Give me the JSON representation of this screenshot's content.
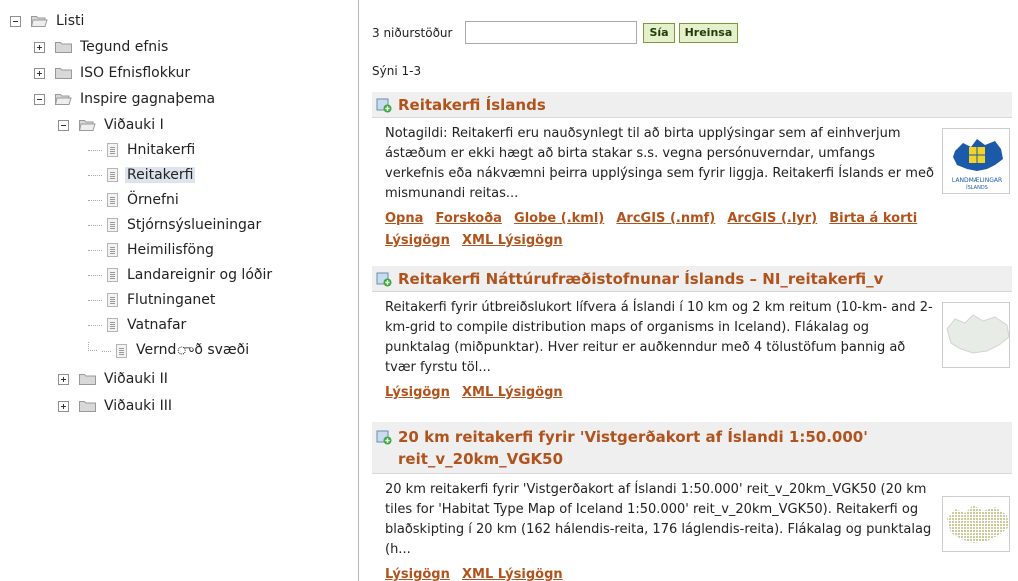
{
  "tree": {
    "root": "Listi",
    "nodes": [
      {
        "label": "Tegund efnis"
      },
      {
        "label": "ISO Efnisflokkur"
      },
      {
        "label": "Inspire gagnaþema"
      },
      {
        "label": "Viðauki I"
      },
      {
        "label": "Hnitakerfi"
      },
      {
        "label": "Reitakerfi"
      },
      {
        "label": "Örnefni"
      },
      {
        "label": "Stjórnsýslueiningar"
      },
      {
        "label": "Heimilisföng"
      },
      {
        "label": "Landareignir og lóðir"
      },
      {
        "label": "Flutninganet"
      },
      {
        "label": "Vatnafar"
      },
      {
        "label": "Verndுð svæði"
      },
      {
        "label": "Viðauki II"
      },
      {
        "label": "Viðauki III"
      }
    ]
  },
  "search": {
    "count_label": "3 niðurstöður",
    "filter_value": "",
    "filter_button": "Sía",
    "clear_button": "Hreinsa",
    "showing": "Sýni 1-3"
  },
  "records": [
    {
      "title": "Reitakerfi Íslands",
      "description": "Notagildi: Reitakerfi eru nauðsynlegt til að birta upplýsingar sem af einhverjum ástæðum er ekki hægt að birta stakar s.s. vegna persónuverndar, umfangs verkefnis eða nákvæmni þeirra upplýsinga sem fyrir liggja. Reitakerfi Íslands er með mismunandi reitas...",
      "thumb_caption_1": "LANDMÆLINGAR",
      "thumb_caption_2": "ÍSLANDS",
      "links": [
        "Opna",
        "Forskoða",
        "Globe (.kml)",
        "ArcGIS (.nmf)",
        "ArcGIS (.lyr)",
        "Birta á korti",
        "Lýsigögn",
        "XML Lýsigögn"
      ]
    },
    {
      "title": "Reitakerfi Náttúrufræðistofnunar Íslands – NI_reitakerfi_v",
      "description": "Reitakerfi fyrir útbreiðslukort lífvera á Íslandi í 10 km og 2 km reitum (10-km- and 2-km-grid to compile distribution maps of organisms in Iceland). Flákalag og punktalag (miðpunktar). Hver reitur er auðkenndur með 4 tölustöfum þannig að tvær fyrstu töl...",
      "links": [
        "Lýsigögn",
        "XML Lýsigögn"
      ]
    },
    {
      "title": "20 km reitakerfi fyrir 'Vistgerðakort af Íslandi 1:50.000' reit_v_20km_VGK50",
      "description": "20 km reitakerfi fyrir 'Vistgerðakort af Íslandi 1:50.000' reit_v_20km_VGK50 (20 km tiles for 'Habitat Type Map of Iceland 1:50.000' reit_v_20km_VGK50). Reitakerfi og blaðskipting í 20 km (162 hálendis-reita, 176 láglendis-reita). Flákalag og punktalag (h...",
      "links": [
        "Lýsigögn",
        "XML Lýsigögn"
      ]
    }
  ]
}
